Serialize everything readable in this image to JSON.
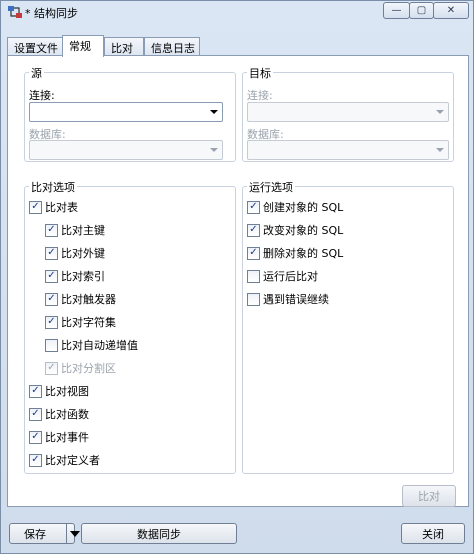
{
  "window": {
    "title": "* 结构同步",
    "min_glyph": "—",
    "max_glyph": "▢",
    "close_glyph": "✕"
  },
  "tabs": [
    {
      "label": "设置文件",
      "active": false
    },
    {
      "label": "常规",
      "active": true
    },
    {
      "label": "比对",
      "active": false
    },
    {
      "label": "信息日志",
      "active": false
    }
  ],
  "source": {
    "title": "源",
    "connection_label": "连接:",
    "connection_value": "",
    "database_label": "数据库:",
    "database_value": ""
  },
  "target": {
    "title": "目标",
    "connection_label": "连接:",
    "connection_value": "",
    "database_label": "数据库:",
    "database_value": ""
  },
  "compare_options": {
    "title": "比对选项",
    "items": [
      {
        "label": "比对表",
        "checked": true,
        "disabled": false
      },
      {
        "label": "比对主键",
        "checked": true,
        "disabled": false
      },
      {
        "label": "比对外键",
        "checked": true,
        "disabled": false
      },
      {
        "label": "比对索引",
        "checked": true,
        "disabled": false
      },
      {
        "label": "比对触发器",
        "checked": true,
        "disabled": false
      },
      {
        "label": "比对字符集",
        "checked": true,
        "disabled": false
      },
      {
        "label": "比对自动递增值",
        "checked": false,
        "disabled": false
      },
      {
        "label": "比对分割区",
        "checked": true,
        "disabled": true
      },
      {
        "label": "比对视图",
        "checked": true,
        "disabled": false
      },
      {
        "label": "比对函数",
        "checked": true,
        "disabled": false
      },
      {
        "label": "比对事件",
        "checked": true,
        "disabled": false
      },
      {
        "label": "比对定义者",
        "checked": true,
        "disabled": false
      }
    ]
  },
  "run_options": {
    "title": "运行选项",
    "items": [
      {
        "label": "创建对象的 SQL",
        "checked": true
      },
      {
        "label": "改变对象的 SQL",
        "checked": true
      },
      {
        "label": "删除对象的 SQL",
        "checked": true
      },
      {
        "label": "运行后比对",
        "checked": false
      },
      {
        "label": "遇到错误继续",
        "checked": false
      }
    ]
  },
  "buttons": {
    "compare": "比对",
    "save": "保存",
    "sync": "数据同步",
    "close": "关闭"
  },
  "colors": {
    "check_mark": "#1d3b8b",
    "disabled_text": "#9aa3ad"
  }
}
